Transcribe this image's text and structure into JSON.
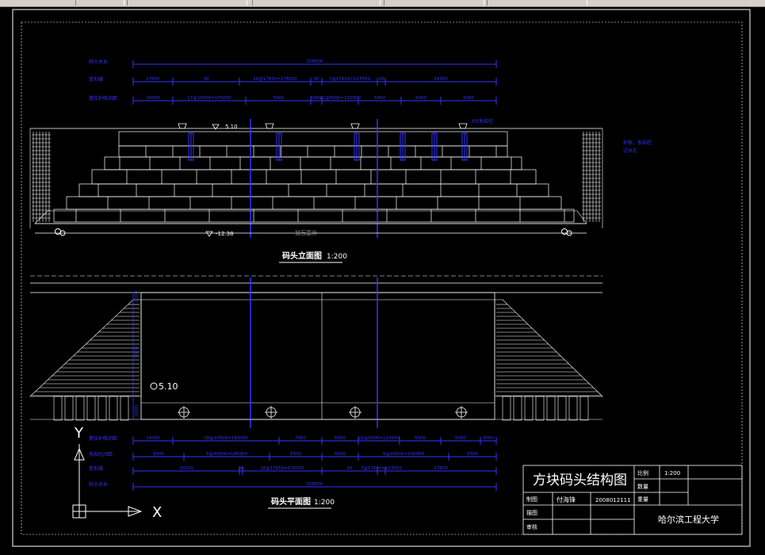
{
  "colors": {
    "background": "#000000",
    "lines": "#ffffff",
    "dims": "#3333ff",
    "frame": "#ffffff"
  },
  "elevation": {
    "title": "码头立面图",
    "scale": "1:200",
    "top_level": "5.10",
    "bottom_level": "-12.38",
    "note_right_1": "护舷、系船柱",
    "note_right_2": "过水孔",
    "foundation_note": "抛石基床",
    "top_note": "30t系船柱"
  },
  "plan": {
    "title": "码头平面图",
    "scale": "1:200",
    "level_marker": "5.10",
    "left_dims": [
      "1000",
      "1000",
      "1000"
    ]
  },
  "top_dims": {
    "rows": [
      {
        "label": "码头总长",
        "values": [
          "328000"
        ]
      },
      {
        "label": "变形缝",
        "values": [
          "17650",
          "30",
          "10@17650=176500",
          "30",
          "7@17650=123550",
          "30",
          "24350"
        ]
      },
      {
        "label": "搅拉护舷间距",
        "values": [
          "10000",
          "17@10000=170000",
          "7000",
          "5000",
          "22@5000=110000",
          "5000",
          "5000",
          "5000"
        ]
      }
    ]
  },
  "bottom_dims": {
    "rows": [
      {
        "label": "搅拉护舷间距",
        "values": [
          "10000",
          "18@10000=180000",
          "7000",
          "6000",
          "22@5000=110000",
          "5000",
          "5000",
          "5000"
        ]
      },
      {
        "label": "系船柱间距",
        "values": [
          "5500",
          "6@30000=180000",
          "5500",
          "5500",
          "5@20000=100000",
          "5500"
        ]
      },
      {
        "label": "变形缝",
        "values": [
          "20100",
          "30",
          "10@17650=176500",
          "30",
          "7@17650=123550",
          "17650"
        ]
      },
      {
        "label": "码头总长",
        "values": [
          "328000"
        ]
      }
    ]
  },
  "title_block": {
    "drawing_title": "方块码头结构图",
    "scale_label": "比例",
    "scale_value": "1:200",
    "qty_label": "数量",
    "weight_label": "重量",
    "row1_label": "制图",
    "drafter": "付海锋",
    "student_id": "2008012111",
    "row2_label": "描图",
    "row3_label": "审核",
    "institution": "哈尔滨工程大学"
  },
  "ucs": {
    "y_label": "Y",
    "x_label": "X"
  }
}
